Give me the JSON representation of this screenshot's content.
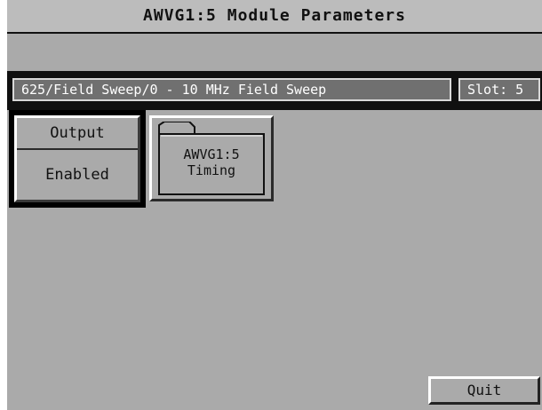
{
  "window": {
    "title": "AWVG1:5  Module Parameters"
  },
  "info_bar": {
    "path": "625/Field Sweep/0 - 10 MHz  Field Sweep",
    "slot": "Slot: 5"
  },
  "output": {
    "label": "Output",
    "value": "Enabled"
  },
  "timing_folder": {
    "line1": "AWVG1:5",
    "line2": "Timing",
    "icon": "folder-icon"
  },
  "footer": {
    "quit_label": "Quit"
  }
}
